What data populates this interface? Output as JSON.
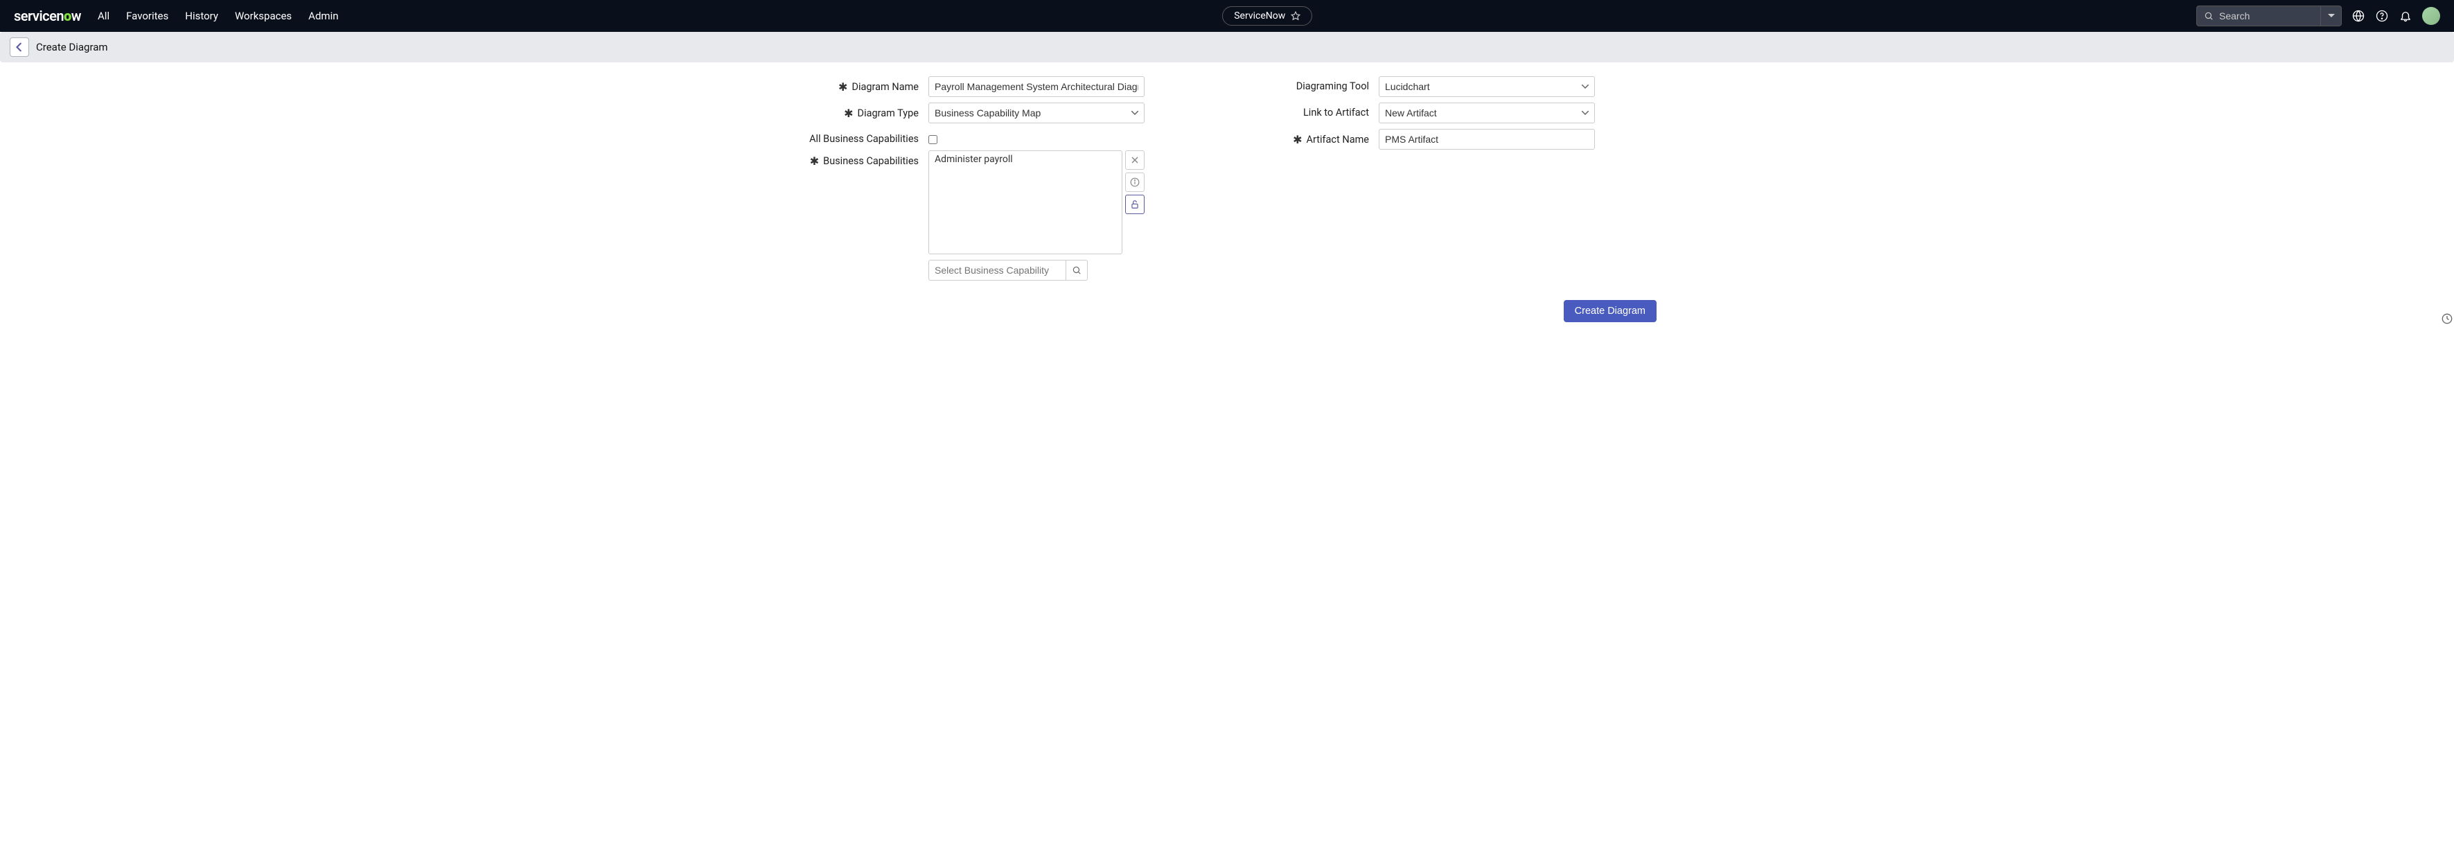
{
  "nav": {
    "logo_pre": "servicen",
    "logo_o": "o",
    "logo_post": "w",
    "links": [
      "All",
      "Favorites",
      "History",
      "Workspaces",
      "Admin"
    ],
    "pill_label": "ServiceNow",
    "search_placeholder": "Search"
  },
  "subheader": {
    "title": "Create Diagram"
  },
  "form": {
    "left": {
      "diagram_name": {
        "label": "Diagram Name",
        "value": "Payroll Management System Architectural Diagram",
        "required": true
      },
      "diagram_type": {
        "label": "Diagram Type",
        "value": "Business Capability Map",
        "required": true
      },
      "all_caps": {
        "label": "All Business Capabilities",
        "checked": false
      },
      "business_caps": {
        "label": "Business Capabilities",
        "required": true,
        "items": [
          "Administer payroll"
        ],
        "lookup_placeholder": "Select Business Capability"
      }
    },
    "right": {
      "diagraming_tool": {
        "label": "Diagraming Tool",
        "value": "Lucidchart"
      },
      "link_artifact": {
        "label": "Link to Artifact",
        "value": "New Artifact"
      },
      "artifact_name": {
        "label": "Artifact Name",
        "value": "PMS Artifact",
        "required": true
      }
    }
  },
  "actions": {
    "submit": "Create Diagram"
  }
}
